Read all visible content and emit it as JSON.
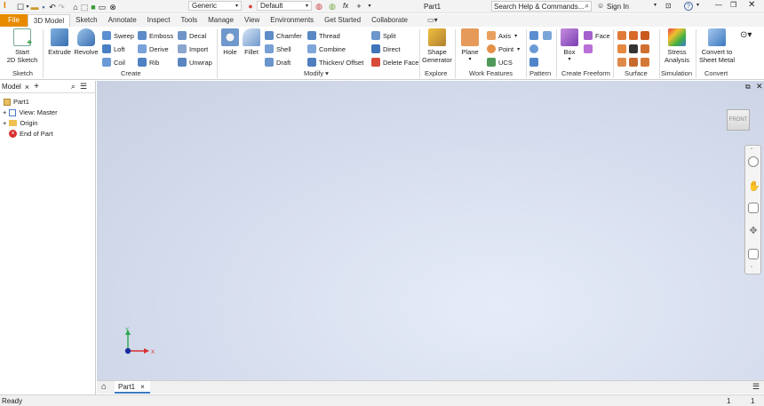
{
  "app": {
    "doc_title": "Part1",
    "search_placeholder": "Search Help & Commands...",
    "sign_in": "Sign In",
    "help": "?",
    "logo": "I"
  },
  "quick_access": {
    "material": "Generic",
    "appearance": "Default",
    "fx": "fx"
  },
  "tabs": [
    "File",
    "3D Model",
    "Sketch",
    "Annotate",
    "Inspect",
    "Tools",
    "Manage",
    "View",
    "Environments",
    "Get Started",
    "Collaborate"
  ],
  "ribbon": {
    "sketch": {
      "start": "Start",
      "sketch2d": "2D Sketch",
      "group": "Sketch"
    },
    "create": {
      "extrude": "Extrude",
      "revolve": "Revolve",
      "sweep": "Sweep",
      "loft": "Loft",
      "coil": "Coil",
      "emboss": "Emboss",
      "derive": "Derive",
      "rib": "Rib",
      "decal": "Decal",
      "import": "Import",
      "unwrap": "Unwrap",
      "group": "Create"
    },
    "modify": {
      "hole": "Hole",
      "fillet": "Fillet",
      "chamfer": "Chamfer",
      "shell": "Shell",
      "draft": "Draft",
      "thread": "Thread",
      "combine": "Combine",
      "thicken": "Thicken/ Offset",
      "split": "Split",
      "direct": "Direct",
      "delete_face": "Delete Face",
      "group": "Modify ▾"
    },
    "explore": {
      "shape": "Shape",
      "generator": "Generator",
      "group": "Explore"
    },
    "work": {
      "plane": "Plane",
      "axis": "Axis",
      "point": "Point",
      "ucs": "UCS",
      "group": "Work Features"
    },
    "pattern": {
      "group": "Pattern"
    },
    "freeform": {
      "box": "Box",
      "face": "Face",
      "group": "Create Freeform"
    },
    "surface": {
      "group": "Surface"
    },
    "simulation": {
      "stress": "Stress",
      "analysis": "Analysis",
      "group": "Simulation"
    },
    "convert": {
      "convert_to": "Convert to",
      "sheet_metal": "Sheet Metal",
      "group": "Convert"
    }
  },
  "browser": {
    "tab": "Model",
    "close": "×",
    "add": "+",
    "items": [
      {
        "label": "Part1"
      },
      {
        "label": "View: Master"
      },
      {
        "label": "Origin"
      },
      {
        "label": "End of Part"
      }
    ]
  },
  "viewcube": {
    "label": "FRONT"
  },
  "document_tabs": [
    {
      "label": "Part1",
      "close": "×"
    }
  ],
  "status": {
    "text": "Ready",
    "count1": "1",
    "count2": "1"
  },
  "triad": {
    "x": "X",
    "y": "Y"
  }
}
